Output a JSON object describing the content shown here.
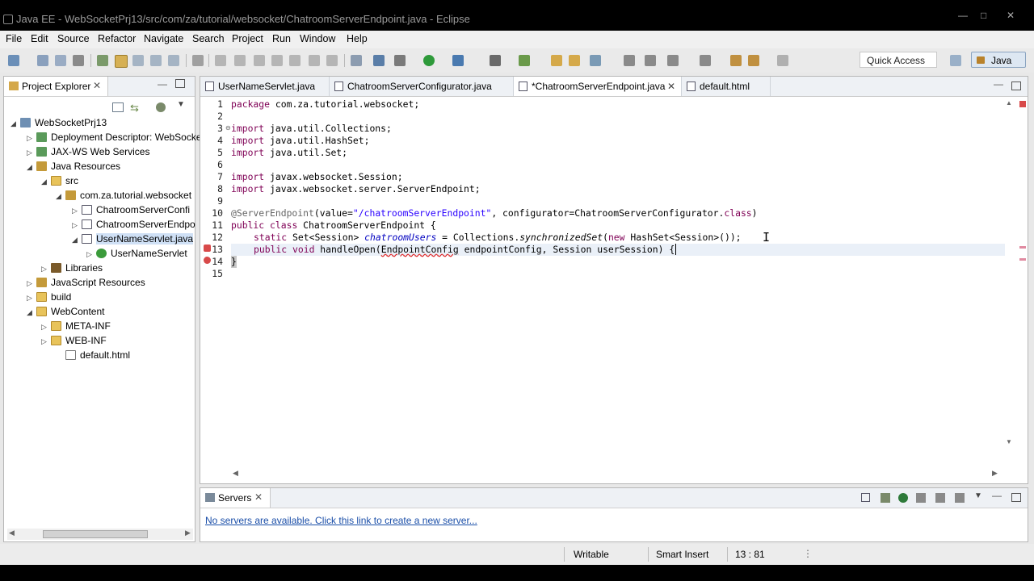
{
  "window": {
    "title": "Java EE - WebSocketPrj13/src/com/za/tutorial/websocket/ChatroomServerEndpoint.java - Eclipse"
  },
  "menu": [
    "File",
    "Edit",
    "Source",
    "Refactor",
    "Navigate",
    "Search",
    "Project",
    "Run",
    "Window",
    "Help"
  ],
  "toolbar": {
    "quick_access": "Quick Access",
    "perspective": "Java EE"
  },
  "project_explorer": {
    "title": "Project Explorer",
    "items": [
      {
        "label": "WebSocketPrj13",
        "icon": "project-icon"
      },
      {
        "label": "Deployment Descriptor: WebSocke",
        "icon": "descriptor-icon"
      },
      {
        "label": "JAX-WS Web Services",
        "icon": "webservices-icon"
      },
      {
        "label": "Java Resources",
        "icon": "java-resources-icon"
      },
      {
        "label": "src",
        "icon": "source-folder-icon"
      },
      {
        "label": "com.za.tutorial.websocket",
        "icon": "package-icon"
      },
      {
        "label": "ChatroomServerConfi",
        "icon": "java-file-icon"
      },
      {
        "label": "ChatroomServerEndpo",
        "icon": "java-file-icon"
      },
      {
        "label": "UserNameServlet.java",
        "icon": "java-file-icon"
      },
      {
        "label": "UserNameServlet",
        "icon": "class-icon"
      },
      {
        "label": "Libraries",
        "icon": "libraries-icon"
      },
      {
        "label": "JavaScript Resources",
        "icon": "js-resources-icon"
      },
      {
        "label": "build",
        "icon": "folder-icon"
      },
      {
        "label": "WebContent",
        "icon": "folder-icon"
      },
      {
        "label": "META-INF",
        "icon": "folder-icon"
      },
      {
        "label": "WEB-INF",
        "icon": "folder-icon"
      },
      {
        "label": "default.html",
        "icon": "html-file-icon"
      }
    ]
  },
  "editor": {
    "tabs": [
      {
        "label": "UserNameServlet.java"
      },
      {
        "label": "ChatroomServerConfigurator.java"
      },
      {
        "label": "*ChatroomServerEndpoint.java"
      },
      {
        "label": "default.html"
      }
    ],
    "line_numbers": [
      "1",
      "2",
      "3",
      "4",
      "5",
      "6",
      "7",
      "8",
      "9",
      "10",
      "11",
      "12",
      "13",
      "14",
      "15"
    ],
    "code": {
      "l1_kw": "package",
      "l1_rest": " com.za.tutorial.websocket;",
      "l3_kw": "import",
      "l3_rest": " java.util.Collections;",
      "l4_kw": "import",
      "l4_rest": " java.util.HashSet;",
      "l5_kw": "import",
      "l5_rest": " java.util.Set;",
      "l7_kw": "import",
      "l7_rest": " javax.websocket.Session;",
      "l8_kw": "import",
      "l8_rest": " javax.websocket.server.ServerEndpoint;",
      "l10_ann": "@ServerEndpoint",
      "l10_a": "(value=",
      "l10_str": "\"/chatroomServerEndpoint\"",
      "l10_b": ", configurator=ChatroomServerConfigurator.",
      "l10_kw": "class",
      "l10_c": ")",
      "l11_kw1": "public",
      "l11_kw2": "class",
      "l11_rest": " ChatroomServerEndpoint {",
      "l12_kw": "static",
      "l12_a": " Set<Session> ",
      "l12_field": "chatroomUsers",
      "l12_b": " = Collections.",
      "l12_it": "synchronizedSet",
      "l12_c": "(",
      "l12_kw2": "new",
      "l12_d": " HashSet<Session>());",
      "l13_kw1": "public",
      "l13_kw2": "void",
      "l13_a": " handleOpen(",
      "l13_err": "EndpointConfig",
      "l13_b": " endpointConfig, Session userSession) {",
      "l14": "}"
    }
  },
  "servers": {
    "title": "Servers",
    "link": "No servers are available. Click this link to create a new server..."
  },
  "status": {
    "writable": "Writable",
    "insert_mode": "Smart Insert",
    "position": "13 : 81"
  }
}
